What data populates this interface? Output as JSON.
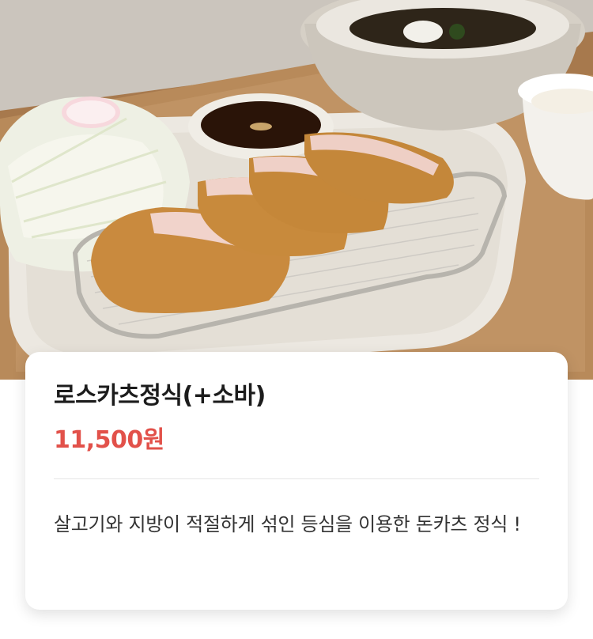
{
  "menu_item": {
    "image_alt": "로스카츠정식(+소바)",
    "name": "로스카츠정식(+소바)",
    "price": "11,500원",
    "description": "살고기와 지방이 적절하게 섞인 등심을 이용한 돈카츠 정식 !"
  },
  "colors": {
    "price": "#e2514a",
    "title": "#1c1c1c",
    "description": "#333333",
    "card_background": "#ffffff"
  }
}
